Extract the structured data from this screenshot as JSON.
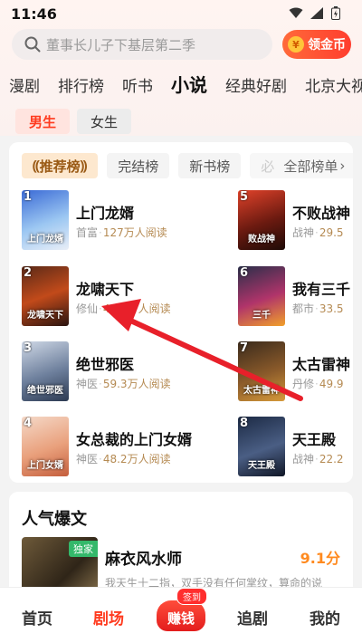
{
  "status": {
    "time": "11:46"
  },
  "search": {
    "placeholder": "董事长儿子下基层第二季",
    "coin_label": "领金币",
    "coin_symbol": "¥"
  },
  "tabs": [
    "漫剧",
    "排行榜",
    "听书",
    "小说",
    "经典好剧",
    "北京大视"
  ],
  "active_tab": "小说",
  "gender": {
    "male": "男生",
    "female": "女生",
    "active": "男生"
  },
  "rank_tabs": {
    "recommended": "推荐榜",
    "finished": "完结榜",
    "new": "新书榜",
    "must": "必",
    "all": "全部榜单"
  },
  "books_left": [
    {
      "rank": "1",
      "title": "上门龙婿",
      "tag": "首富",
      "reads": "127万人阅读",
      "cover_text": "上门龙婿"
    },
    {
      "rank": "2",
      "title": "龙啸天下",
      "tag": "修仙",
      "reads": "43.0万人阅读",
      "cover_text": "龙啸天下"
    },
    {
      "rank": "3",
      "title": "绝世邪医",
      "tag": "神医",
      "reads": "59.3万人阅读",
      "cover_text": "绝世邪医"
    },
    {
      "rank": "4",
      "title": "女总裁的上门女婿",
      "tag": "神医",
      "reads": "48.2万人阅读",
      "cover_text": "上门女婿"
    }
  ],
  "books_right": [
    {
      "rank": "5",
      "title": "不败战神",
      "tag": "战神",
      "reads": "29.5",
      "cover_text": "败战神"
    },
    {
      "rank": "6",
      "title": "我有三千",
      "tag": "都市",
      "reads": "33.5",
      "cover_text": "三千"
    },
    {
      "rank": "7",
      "title": "太古雷神",
      "tag": "丹修",
      "reads": "49.9",
      "cover_text": "太古雷神"
    },
    {
      "rank": "8",
      "title": "天王殿",
      "tag": "战神",
      "reads": "22.2",
      "cover_text": "天王殿"
    }
  ],
  "popular": {
    "section_title": "人气爆文",
    "title": "麻衣风水师",
    "score": "9.1分",
    "badge": "独家",
    "desc": "我天生十二指，双手没有任何掌纹，算命的说"
  },
  "nav": {
    "home": "首页",
    "theater": "剧场",
    "earn": "赚钱",
    "sign": "签到",
    "follow": "追剧",
    "mine": "我的",
    "active": "剧场"
  },
  "colors": {
    "accent": "#ff3b1f",
    "arrow": "#e8202a",
    "coin": "#ffc53a"
  }
}
